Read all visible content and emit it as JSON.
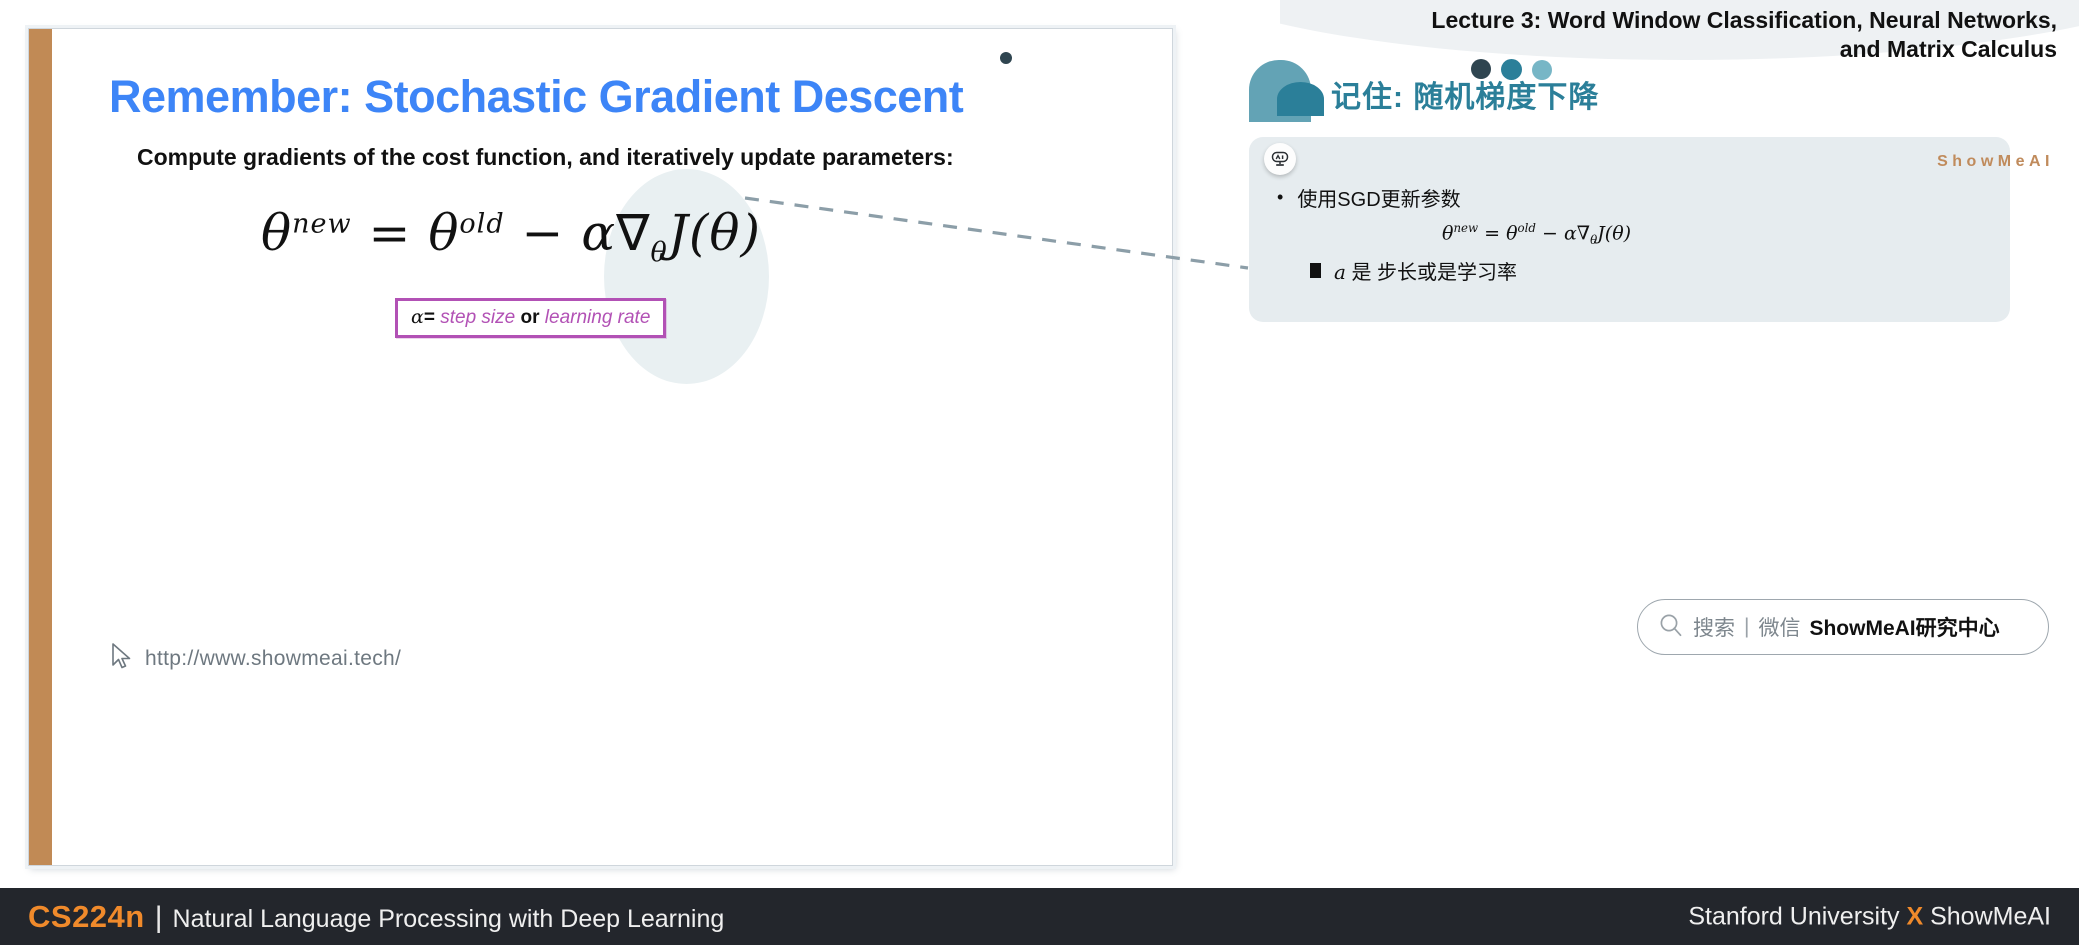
{
  "slide": {
    "title": "Remember: Stochastic Gradient Descent",
    "subtitle": "Compute gradients of the cost function, and iteratively update parameters:",
    "formula_plain": "θ^new = θ^old − α∇_θ J(θ)",
    "formula_parts": {
      "theta1": "θ",
      "sup1": "new",
      "equals": "=",
      "theta2": "θ",
      "sup2": "old",
      "minus": "−",
      "alpha": "α",
      "nabla": "∇",
      "sub_theta": "θ",
      "jay": "J",
      "paren": "(θ)"
    },
    "alpha_box": {
      "alpha": "α",
      "equals": "=",
      "term1": "step size",
      "conjunction": "or",
      "term2": "learning rate"
    },
    "url": "http://www.showmeai.tech/",
    "accent_bar_color": "#c18a55",
    "title_color": "#3d85f7",
    "alpha_box_color": "#b251b5"
  },
  "header": {
    "lecture_title": "Lecture 3:  Word Window Classification, Neural Networks, and Matrix Calculus",
    "chinese_title": "记住: 随机梯度下降",
    "dots": [
      "#2f4550",
      "#2b7f99",
      "#77b6c6"
    ],
    "title_color": "#2b7f99"
  },
  "note_card": {
    "brand": "ShowMeAI",
    "brand_color": "#c08b5c",
    "bullet": "使用SGD更新参数",
    "bullet_marker": "•",
    "formula_parts": {
      "theta1": "θ",
      "sup1": "new",
      "equals": "=",
      "theta2": "θ",
      "sup2": "old",
      "minus": "−",
      "alpha": "α",
      "nabla": "∇",
      "sub_theta": "θ",
      "jay": "J",
      "paren": "(θ)"
    },
    "formula_plain": "θ^new = θ^old − α∇_θJ(θ)",
    "sub_alpha": "a",
    "sub_text": "是 步长或是学习率",
    "background": "#e6ecef"
  },
  "wechat_search": {
    "search_label": "搜索",
    "separator": "|",
    "platform": "微信",
    "brand": "ShowMeAI研究中心"
  },
  "footer": {
    "course_code": "CS224n",
    "divider": "|",
    "course_name": "Natural Language Processing with Deep Learning",
    "right_pre": "Stanford University ",
    "right_x": "X",
    "right_post": " ShowMeAI",
    "accent_color": "#f08a2b",
    "background": "#23262c"
  }
}
